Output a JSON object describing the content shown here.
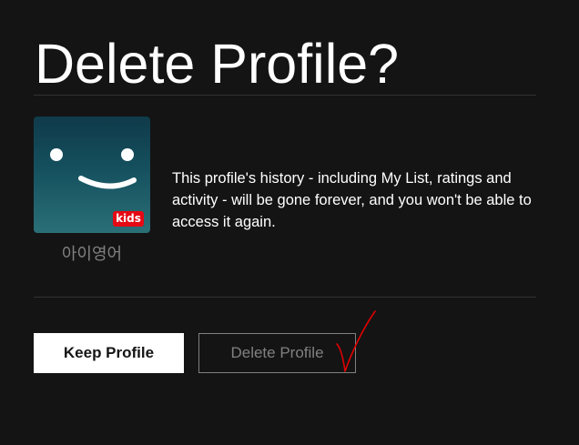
{
  "dialog": {
    "title": "Delete Profile?",
    "message": "This profile's history - including My List, ratings and activity - will be gone forever, and you won't be able to access it again."
  },
  "profile": {
    "name": "아이영어",
    "badge": "kids",
    "avatar_icon": "smiley-face-icon"
  },
  "actions": {
    "keep_label": "Keep Profile",
    "delete_label": "Delete Profile"
  },
  "annotation": {
    "icon": "red-checkmark-icon",
    "color": "#e00000"
  },
  "colors": {
    "background": "#141414",
    "accent": "#e50914",
    "muted_text": "#808080"
  }
}
